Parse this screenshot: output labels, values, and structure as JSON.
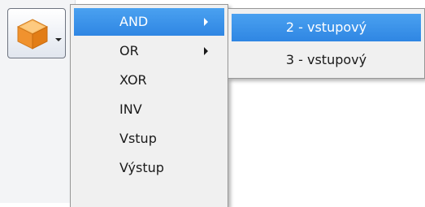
{
  "toolbar": {
    "button_icon": "cube-icon",
    "button_accent": "#f2a03d"
  },
  "menu": {
    "items": [
      {
        "label": "AND",
        "has_submenu": true,
        "highlighted": true
      },
      {
        "label": "OR",
        "has_submenu": true,
        "highlighted": false
      },
      {
        "label": "XOR",
        "has_submenu": false,
        "highlighted": false
      },
      {
        "label": "INV",
        "has_submenu": false,
        "highlighted": false
      },
      {
        "label": "Vstup",
        "has_submenu": false,
        "highlighted": false
      },
      {
        "label": "Výstup",
        "has_submenu": false,
        "highlighted": false
      }
    ]
  },
  "submenu": {
    "items": [
      {
        "label": "2 - vstupový",
        "highlighted": true
      },
      {
        "label": "3 - vstupový",
        "highlighted": false
      }
    ]
  },
  "colors": {
    "highlight": "#3a92e9",
    "menu_background": "#f0f0f0"
  }
}
